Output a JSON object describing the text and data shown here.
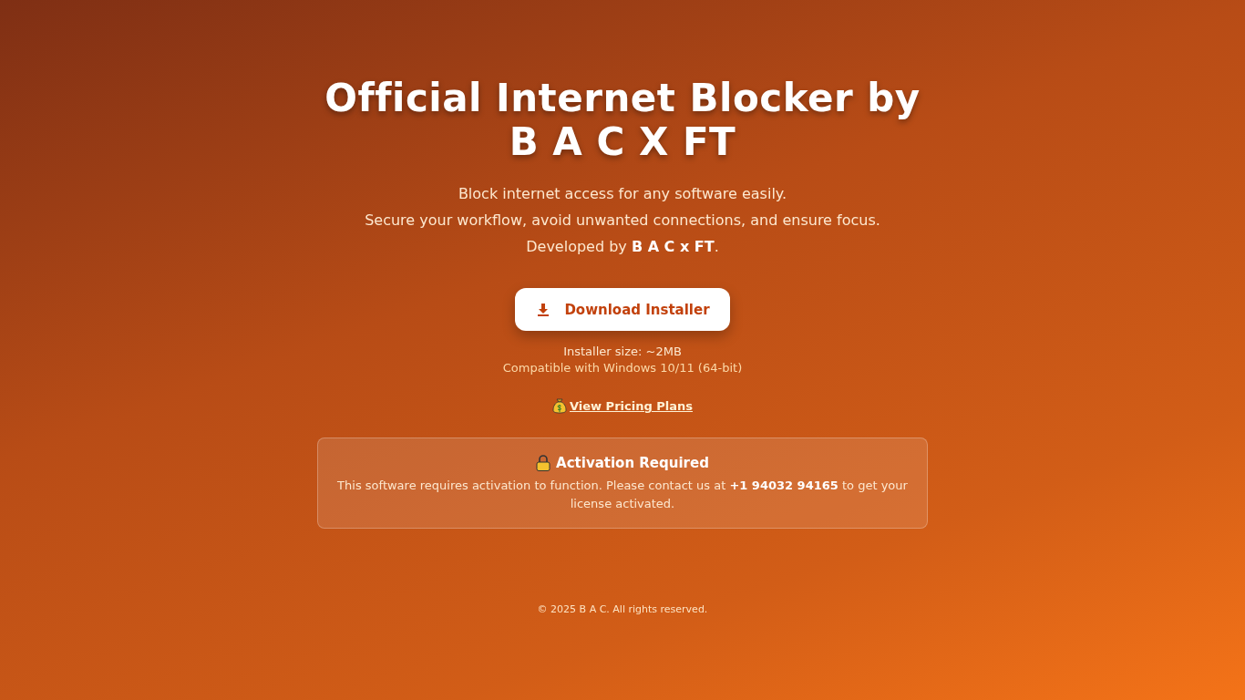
{
  "title_lines": [
    "Official Internet Blocker by",
    "B A C X FT"
  ],
  "intro_lines": [
    "Block internet access for any software easily.",
    "Secure your workflow, avoid unwanted connections, and ensure focus.",
    "Developed by **B A C x FT**."
  ],
  "download_button": {
    "label": "Download Installer"
  },
  "installer_size": "Installer size: ~2MB",
  "compatibility": "Compatible with Windows 10/11 (64-bit)",
  "pricing_link": "View Pricing Plans",
  "notice": {
    "title": "Activation Required",
    "text": "This software requires activation to function. Please contact us at **+1 94032 94165** to get your license activated."
  },
  "footer": "© 2025 B A C. All rights reserved."
}
